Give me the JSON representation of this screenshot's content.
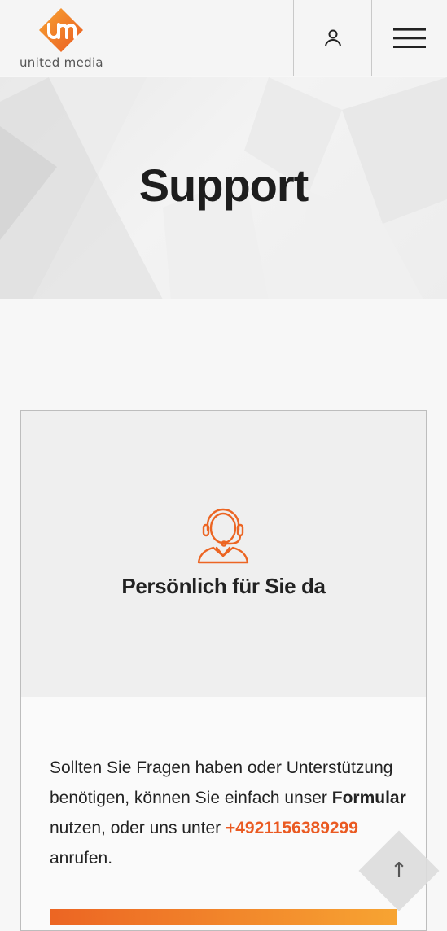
{
  "header": {
    "logo_text": "united media",
    "account_icon": "user-icon",
    "menu_icon": "hamburger-menu-icon"
  },
  "hero": {
    "title": "Support"
  },
  "card": {
    "icon": "headset-support-agent-icon",
    "title": "Persönlich für Sie da",
    "text_part1": "Sollten Sie Fragen haben oder Unterstützung benötigen, können Sie einfach unser ",
    "form_link": "Formular",
    "text_part2": " nutzen, oder uns unter ",
    "phone": "+4921156389299",
    "text_part3": " anrufen."
  },
  "scroll_top": {
    "icon": "arrow-up-icon",
    "label": "↑"
  },
  "colors": {
    "accent_orange": "#ea5a22",
    "gradient_start": "#ec6523",
    "gradient_end": "#f7a432"
  }
}
